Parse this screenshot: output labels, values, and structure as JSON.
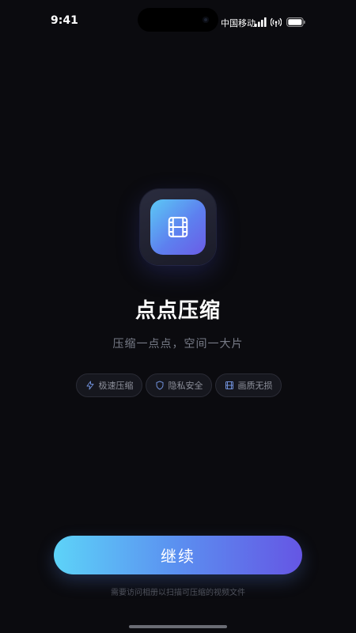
{
  "status_bar": {
    "time": "9:41",
    "carrier": "中国移动",
    "icons": [
      "signal-icon",
      "hotspot-icon",
      "battery-icon"
    ]
  },
  "app": {
    "icon": "film-icon",
    "title": "点点压缩",
    "subtitle": "压缩一点点，空间一大片"
  },
  "features": [
    {
      "icon": "lightning-icon",
      "label": "极速压缩"
    },
    {
      "icon": "shield-icon",
      "label": "隐私安全"
    },
    {
      "icon": "film-icon",
      "label": "画质无损"
    }
  ],
  "actions": {
    "continue_label": "继续",
    "permission_note": "需要访问相册以扫描可压缩的视频文件"
  },
  "colors": {
    "background": "#0b0b0f",
    "accent_start": "#5dd3f8",
    "accent_end": "#6556e4",
    "chip_icon": "#6f8fd8"
  }
}
